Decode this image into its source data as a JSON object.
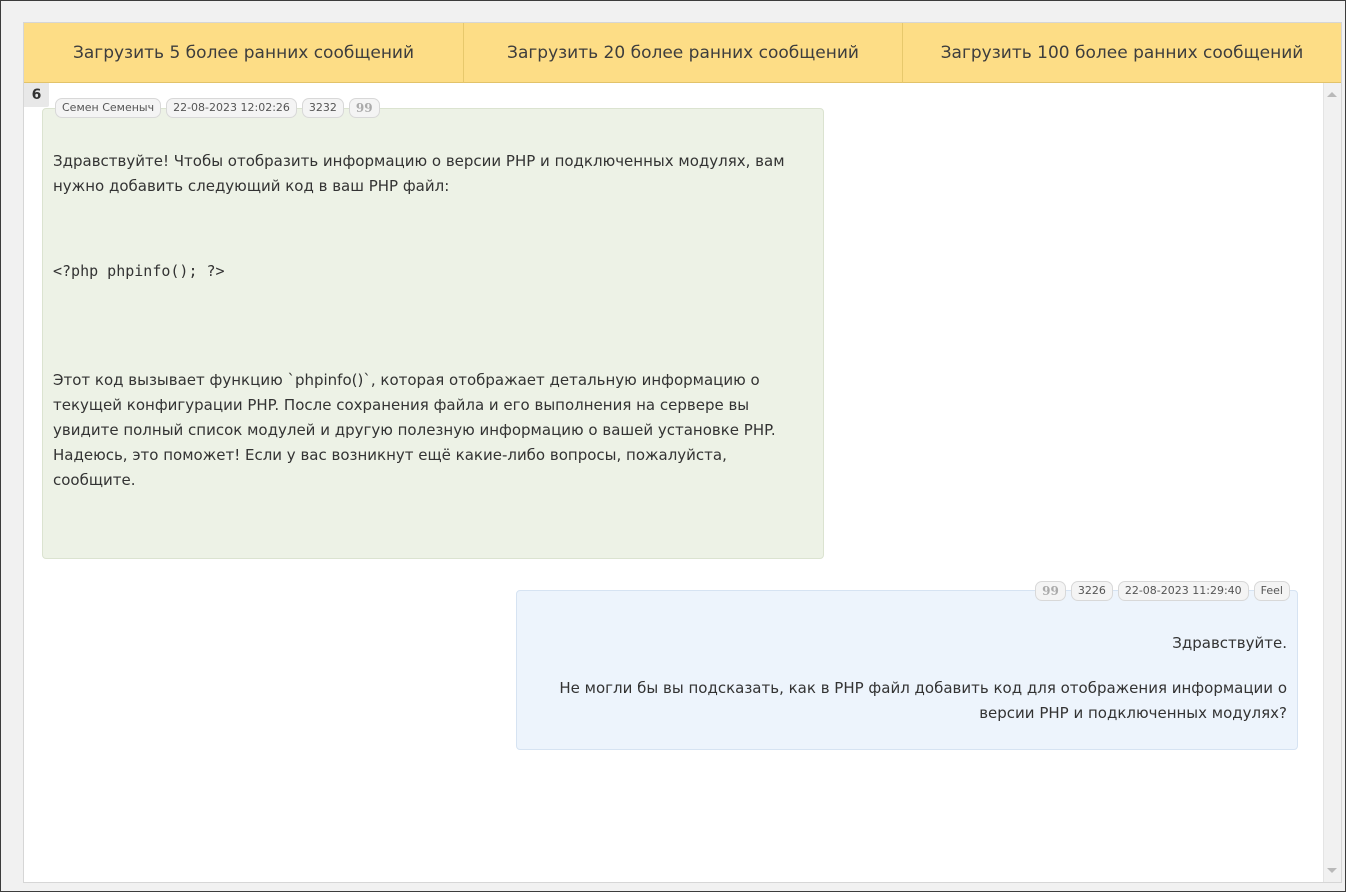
{
  "load_bar": {
    "load5": "Загрузить 5 более ранних сообщений",
    "load20": "Загрузить 20 более ранних сообщений",
    "load100": "Загрузить 100 более ранних сообщений"
  },
  "chat": {
    "counter": "6",
    "incoming": {
      "author": "Семен Семеныч",
      "datetime": "22-08-2023 12:02:26",
      "id": "3232",
      "quote_icon": "99",
      "text1": "Здравствуйте! Чтобы отобразить информацию о версии PHP и подключенных модулях, вам нужно добавить следующий код в ваш PHP файл:",
      "code": "<?php phpinfo(); ?>",
      "text2": "Этот код вызывает функцию `phpinfo()`, которая отображает детальную информацию о текущей конфигурации PHP. После сохранения файла и его выполнения на сервере вы увидите полный список модулей и другую полезную информацию о вашей установке PHP. Надеюсь, это поможет! Если у вас возникнут ещё какие-либо вопросы, пожалуйста, сообщите."
    },
    "outgoing": {
      "quote_icon": "99",
      "id": "3226",
      "datetime": "22-08-2023 11:29:40",
      "author": "Feel",
      "line1": "Здравствуйте.",
      "line2": "Не могли бы вы подсказать, как в PHP файл добавить код для отображения информации о версии PHP и подключенных модулях?"
    }
  },
  "colors": {
    "load_button_bg": "#fddd86",
    "incoming_bubble_bg": "#edf2e6",
    "outgoing_bubble_bg": "#edf4fc"
  }
}
